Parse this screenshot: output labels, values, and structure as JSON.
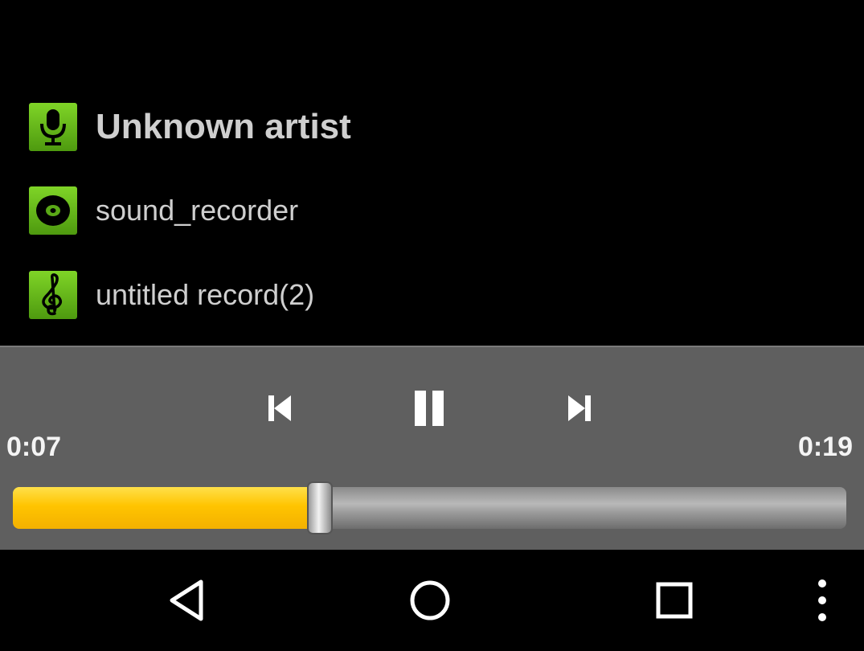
{
  "track_info": {
    "artist": "Unknown artist",
    "album": "sound_recorder",
    "title": "untitled record(2)"
  },
  "icons": {
    "artist": "microphone-icon",
    "album": "disc-icon",
    "title": "treble-clef-icon"
  },
  "player": {
    "elapsed": "0:07",
    "duration": "0:19",
    "progress": 0.368
  },
  "colors": {
    "accent": "#ffc400",
    "icon_green": "#6cc01f",
    "controls_bg": "#5f5f5f"
  }
}
